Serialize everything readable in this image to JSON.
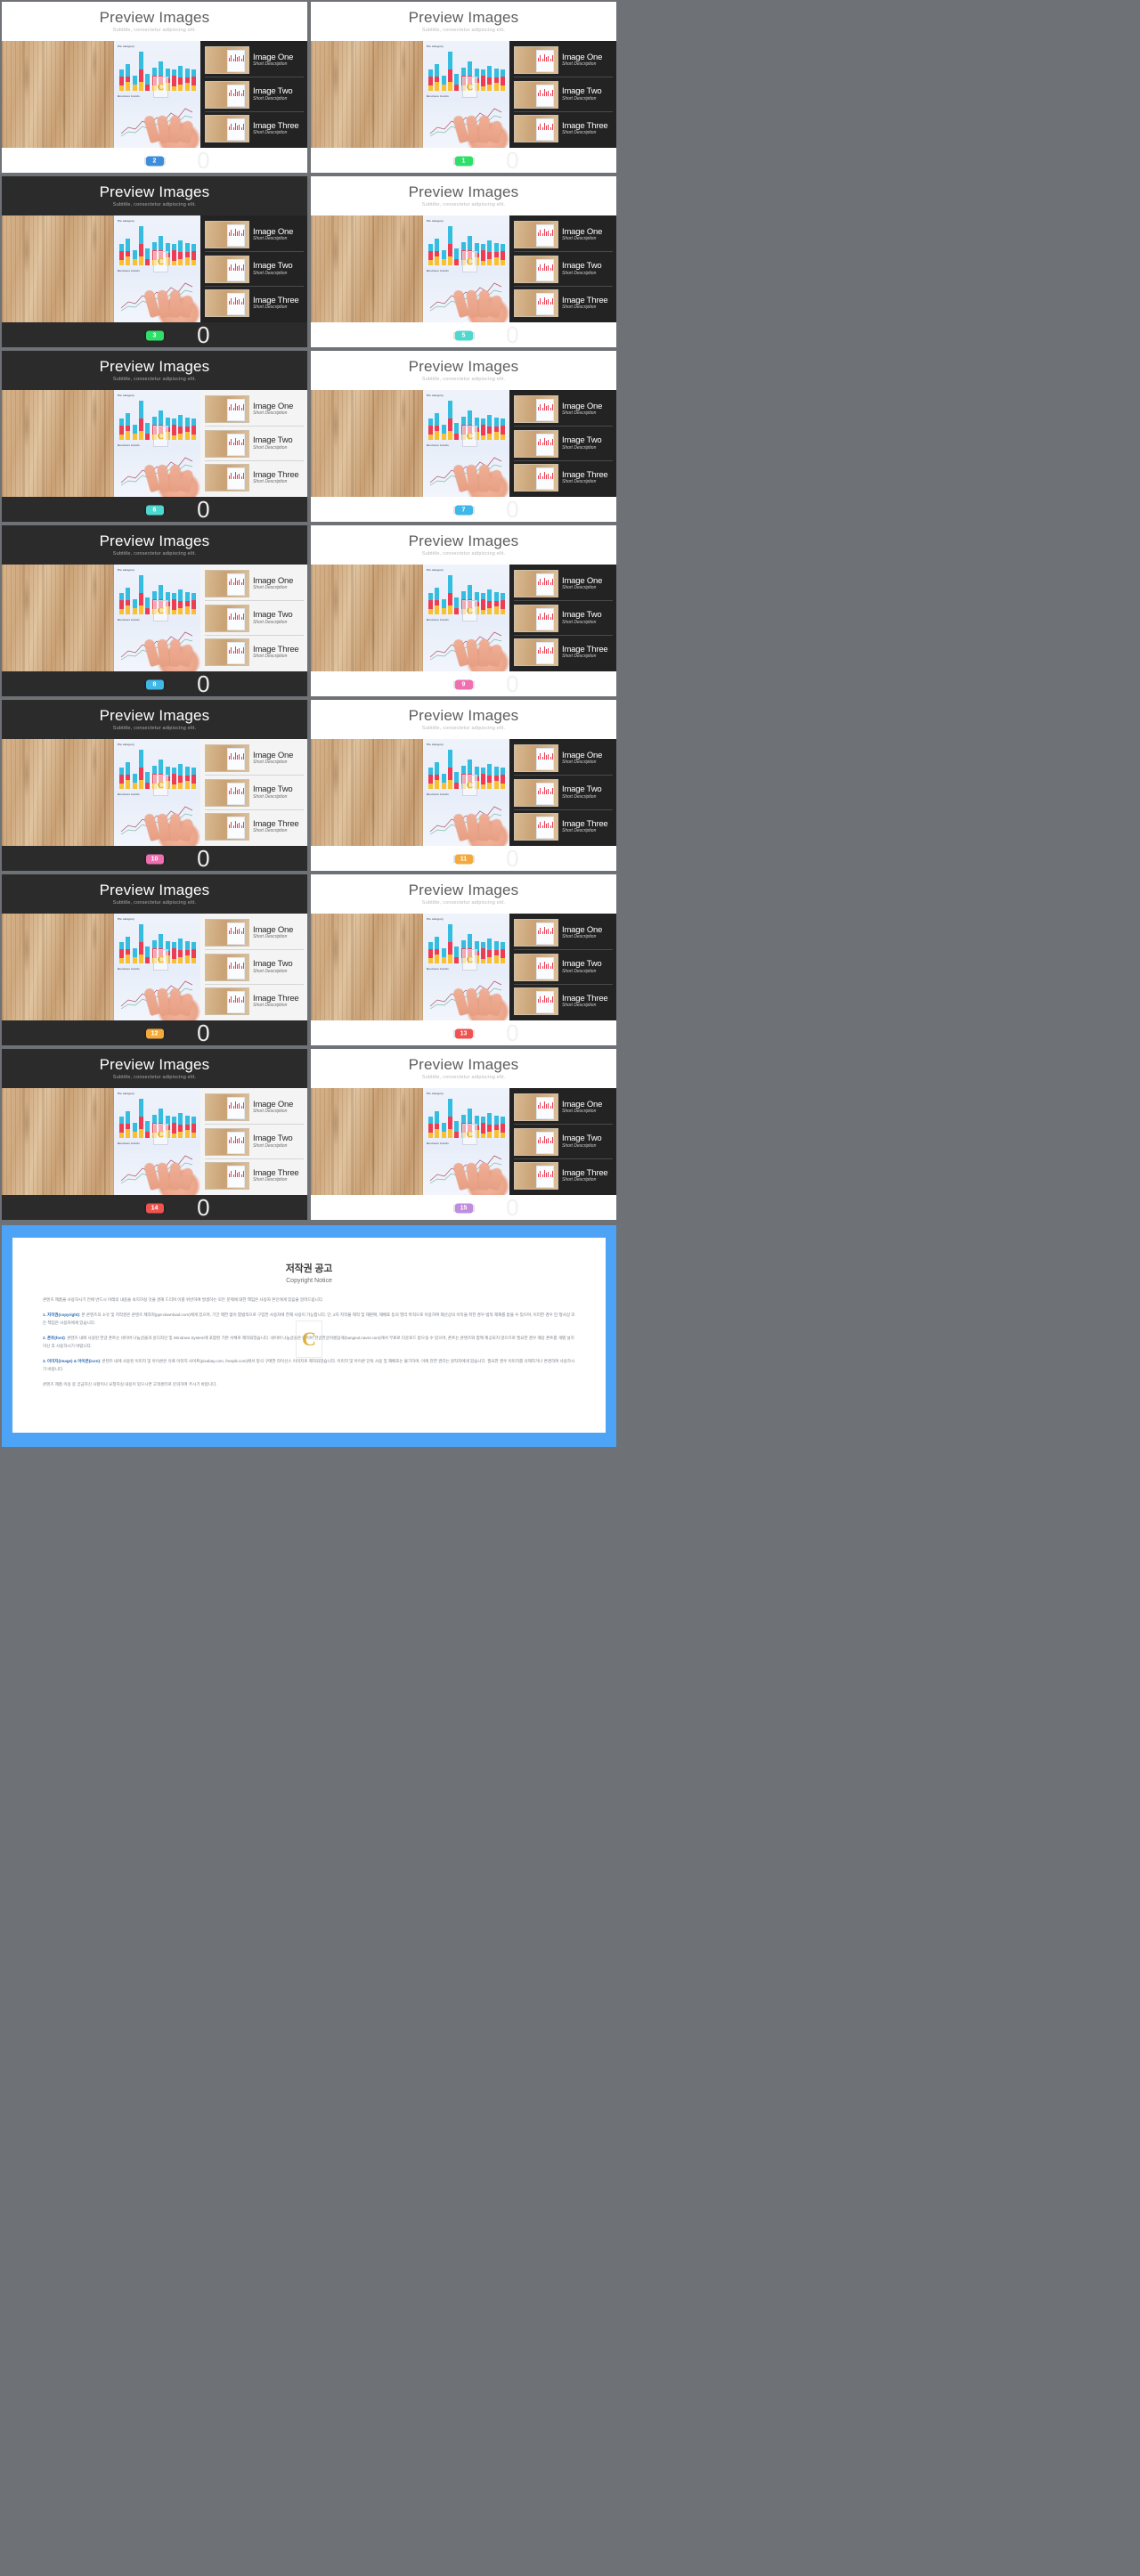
{
  "slide": {
    "title": "Preview Images",
    "subtitle": "Subtitle, consectetur adipiscing elit.",
    "chart_label_top": "Pie category",
    "chart_label_bottom": "Business trends",
    "logo_letter": "C",
    "panel_items": [
      {
        "title": "Image One",
        "desc": "Short Description"
      },
      {
        "title": "Image Two",
        "desc": "Short Description"
      },
      {
        "title": "Image Three",
        "desc": "Short Description"
      }
    ],
    "zero_label": "0"
  },
  "slides": [
    {
      "index": 1,
      "theme": "light",
      "panel": "dark",
      "badge": "2",
      "badge_color": "#3d8ddb"
    },
    {
      "index": 2,
      "theme": "light",
      "panel": "dark",
      "badge": "1",
      "badge_color": "#2ee06a"
    },
    {
      "index": 3,
      "theme": "dark",
      "panel": "dark",
      "badge": "3",
      "badge_color": "#2ee06a"
    },
    {
      "index": 4,
      "theme": "light",
      "panel": "dark",
      "badge": "5",
      "badge_color": "#4fd8cf"
    },
    {
      "index": 5,
      "theme": "dark",
      "panel": "light",
      "badge": "6",
      "badge_color": "#4fd8cf"
    },
    {
      "index": 6,
      "theme": "light",
      "panel": "dark",
      "badge": "7",
      "badge_color": "#3fb8e8"
    },
    {
      "index": 7,
      "theme": "dark",
      "panel": "light",
      "badge": "8",
      "badge_color": "#3fb8e8"
    },
    {
      "index": 8,
      "theme": "light",
      "panel": "dark",
      "badge": "9",
      "badge_color": "#ef6fb0"
    },
    {
      "index": 9,
      "theme": "dark",
      "panel": "light",
      "badge": "10",
      "badge_color": "#ef6fb0"
    },
    {
      "index": 10,
      "theme": "light",
      "panel": "dark",
      "badge": "11",
      "badge_color": "#f3a93c"
    },
    {
      "index": 11,
      "theme": "dark",
      "panel": "light",
      "badge": "12",
      "badge_color": "#f3a93c"
    },
    {
      "index": 12,
      "theme": "light",
      "panel": "dark",
      "badge": "13",
      "badge_color": "#ef5350"
    },
    {
      "index": 13,
      "theme": "dark",
      "panel": "light",
      "badge": "14",
      "badge_color": "#ef5350"
    },
    {
      "index": 14,
      "theme": "light",
      "panel": "dark",
      "badge": "15",
      "badge_color": "#c08ce0"
    }
  ],
  "copyright": {
    "title": "저작권 공고",
    "subtitle": "Copyright Notice",
    "watermark_letter": "C",
    "intro": "콘텐츠 제품을 사용하시기 전에 반드시 아래의 내용을 숙지하실 것을 권해 드리며 이를 위반하여 발생하는 모든 문제에 대한 책임은 사용자 본인에게 있음을 알려드립니다.",
    "sections": [
      {
        "heading": "1. 저작권(copyright)",
        "body": ": 본 콘텐츠의 소유 및 저작권은 콘텐츠 제작자(ppt-download.com)에게 있으며, 기간 제한 없이 합법적으로 구입한 사용자에 한해 사용이 가능합니다. 단, 2차 저작물 제작 및 재판매, 재배포 등의 영리 목적으로 이용하여 재산상의 이득을 취한 경우 법적 제재를 받을 수 있으며, 이러한 경우 민·형사상 모든 책임은 사용자에게 있습니다."
      },
      {
        "heading": "2. 폰트(font)",
        "body": ": 콘텐츠 내에 사용된 한글 폰트는 네이버 나눔글꼴과 윤디자인 및 Windows System에 포함된 기본 서체로 제작되었습니다. 네이버 나눔글꼴은 네이버 한글한글아름답게(hangeul.naver.com)에서 무료로 다운로드 받으실 수 있으며, 폰트는 콘텐츠와 함께 제공되지 않으므로 필요한 경우 해당 폰트를 개별 설치하신 후 사용하시기 바랍니다."
      },
      {
        "heading": "3. 이미지(image) & 아이콘(icon)",
        "body": ": 콘텐츠 내에 사용된 이미지 및 아이콘은 유료 이미지 사이트(pixabay.com, freepik.com)에서 정식 구매한 라이선스 이미지로 제작되었습니다. 이미지 및 아이콘 단독 사용 및 재배포는 불가하며, 이에 관한 권리는 원작자에게 있습니다. 필요한 경우 이미지를 삭제하거나 변경하여 사용하시기 바랍니다."
      }
    ],
    "outro": "콘텐츠 제품 이용 중 궁금하신 사항이나 요청하실 내용이 있으시면 고객센터로 문의하여 주시기 바랍니다."
  }
}
